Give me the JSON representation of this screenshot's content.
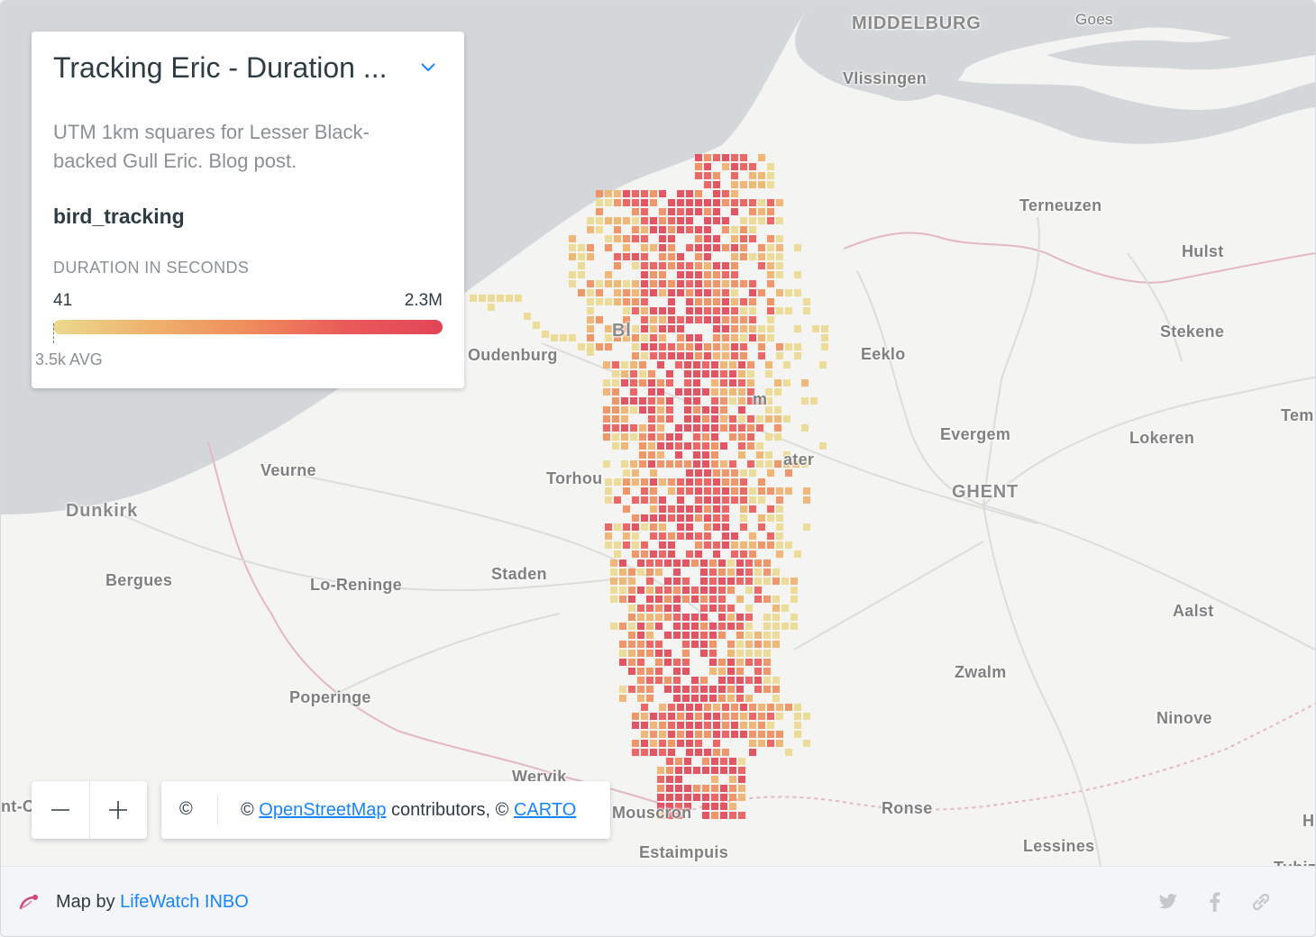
{
  "legend": {
    "title": "Tracking Eric - Duration ...",
    "description": "UTM 1km squares for Lesser Black-backed Gull Eric. Blog post.",
    "layer_name": "bird_tracking",
    "metric_label": "DURATION IN SECONDS",
    "min_value": "41",
    "max_value": "2.3M",
    "avg_label": "3.5k AVG",
    "ramp_colors": [
      "#ecd98f",
      "#efb16c",
      "#ef8d5c",
      "#ea5a5a",
      "#e24557"
    ]
  },
  "map": {
    "places": [
      {
        "name": "MIDDELBURG",
        "style": "big"
      },
      {
        "name": "Goes",
        "style": "normal"
      },
      {
        "name": "Vlissingen",
        "style": "mid"
      },
      {
        "name": "Terneuzen",
        "style": "mid"
      },
      {
        "name": "Hulst",
        "style": "mid"
      },
      {
        "name": "Stekene",
        "style": "mid"
      },
      {
        "name": "Eeklo",
        "style": "mid"
      },
      {
        "name": "Oudenburg",
        "style": "mid"
      },
      {
        "name": "Tem",
        "style": "mid"
      },
      {
        "name": "Evergem",
        "style": "mid"
      },
      {
        "name": "Lokeren",
        "style": "mid"
      },
      {
        "name": "GHENT",
        "style": "big"
      },
      {
        "name": "Veurne",
        "style": "mid"
      },
      {
        "name": "Torhou",
        "style": "mid"
      },
      {
        "name": "Dunkirk",
        "style": "big"
      },
      {
        "name": "Bergues",
        "style": "mid"
      },
      {
        "name": "Lo-Reninge",
        "style": "mid"
      },
      {
        "name": "Staden",
        "style": "mid"
      },
      {
        "name": "Aalst",
        "style": "mid"
      },
      {
        "name": "Zwalm",
        "style": "mid"
      },
      {
        "name": "Poperinge",
        "style": "mid"
      },
      {
        "name": "Ninove",
        "style": "mid"
      },
      {
        "name": "Wervik",
        "style": "mid"
      },
      {
        "name": "Mouscron",
        "style": "mid"
      },
      {
        "name": "Ronse",
        "style": "mid"
      },
      {
        "name": "Lessines",
        "style": "mid"
      },
      {
        "name": "Estaimpuis",
        "style": "mid"
      },
      {
        "name": "Tubiz",
        "style": "mid"
      },
      {
        "name": "H",
        "style": "mid"
      },
      {
        "name": "nt-O",
        "style": "mid"
      },
      {
        "name": "Bl",
        "style": "big"
      },
      {
        "name": "m",
        "style": "mid"
      },
      {
        "name": "ater",
        "style": "mid"
      }
    ],
    "sea_color": "#d4d7d9",
    "land_color": "#f4f4f2"
  },
  "controls": {
    "zoom_out_label": "—",
    "zoom_in_label": "+",
    "copyright_symbol": "©",
    "attribution_prefix": "© ",
    "osm_link": "OpenStreetMap",
    "attribution_mid": " contributors, © ",
    "carto_link": "CARTO"
  },
  "footer": {
    "map_by": "Map by ",
    "author": "LifeWatch INBO",
    "social_icons": [
      "twitter-icon",
      "facebook-icon",
      "link-icon"
    ]
  }
}
